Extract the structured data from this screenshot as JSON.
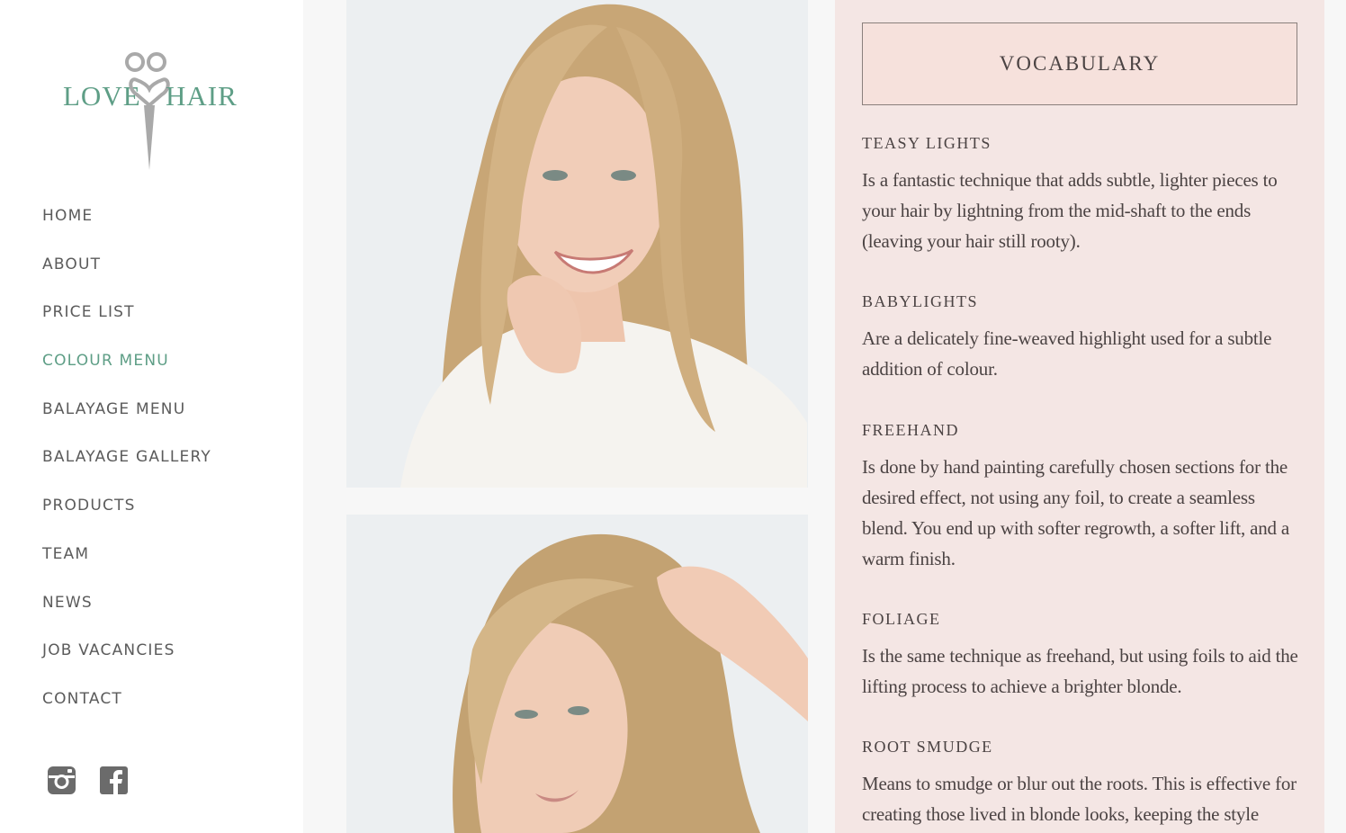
{
  "colors": {
    "brand_green": "#5e9e86",
    "nav_text": "#5b5b5b",
    "nav_active": "#5e9e86",
    "panel_bg": "#f4e6e4",
    "vocab_box_bg": "#f6e1dc",
    "body_text": "#4b4343",
    "icon_grey": "#6b6b6b",
    "scissors_grey": "#a9a9a9"
  },
  "logo": {
    "left_word": "LOVE",
    "right_word": "HAIR",
    "icon": "scissors-heart-icon"
  },
  "nav": {
    "items": [
      {
        "label": "HOME",
        "active": false
      },
      {
        "label": "ABOUT",
        "active": false
      },
      {
        "label": "PRICE LIST",
        "active": false
      },
      {
        "label": "COLOUR MENU",
        "active": true
      },
      {
        "label": "BALAYAGE MENU",
        "active": false
      },
      {
        "label": "BALAYAGE GALLERY",
        "active": false
      },
      {
        "label": "PRODUCTS",
        "active": false
      },
      {
        "label": "TEAM",
        "active": false
      },
      {
        "label": "NEWS",
        "active": false
      },
      {
        "label": "JOB VACANCIES",
        "active": false
      },
      {
        "label": "CONTACT",
        "active": false
      }
    ]
  },
  "social": {
    "icons": [
      "instagram-icon",
      "facebook-icon"
    ]
  },
  "vocabulary": {
    "heading": "VOCABULARY",
    "terms": [
      {
        "title": "TEASY LIGHTS",
        "text": "Is a fantastic technique that adds subtle, lighter pieces to your hair by lightning from the mid-shaft to the ends (leaving your hair still rooty)."
      },
      {
        "title": "BABYLIGHTS",
        "text": "Are a delicately fine-weaved highlight used for a subtle addition of colour."
      },
      {
        "title": "FREEHAND",
        "text": "Is done by hand painting carefully chosen sections for the desired effect, not using any foil, to create a seamless blend. You end up with softer regrowth, a softer lift, and a warm finish."
      },
      {
        "title": "FOLIAGE",
        "text": "Is the same technique as freehand, but using foils to aid the lifting process to achieve a brighter blonde."
      },
      {
        "title": "ROOT SMUDGE",
        "text": "Means to smudge or blur out the roots. This is effective for creating those lived in blonde looks, keeping the style"
      }
    ]
  }
}
